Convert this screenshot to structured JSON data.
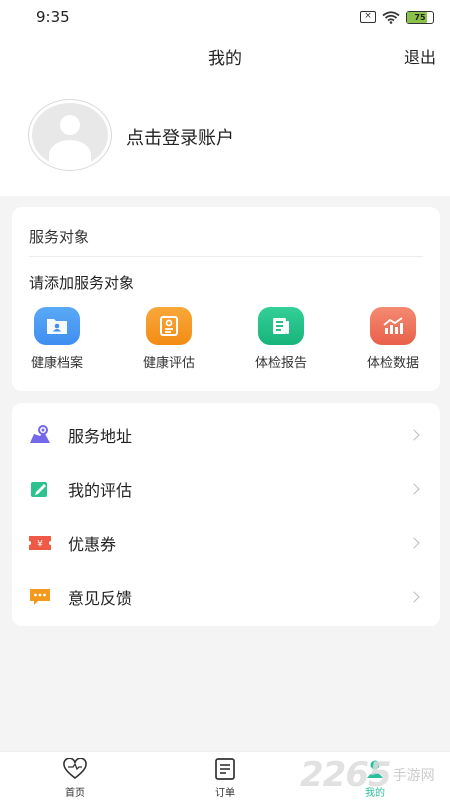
{
  "status_bar": {
    "time": "9:35",
    "battery": "75"
  },
  "header": {
    "title": "我的",
    "logout_label": "退出"
  },
  "profile": {
    "login_text": "点击登录账户"
  },
  "service_card": {
    "title": "服务对象",
    "add_text": "请添加服务对象",
    "items": [
      {
        "label": "健康档案",
        "icon": "folder-icon",
        "color": "#3f97f2"
      },
      {
        "label": "健康评估",
        "icon": "assessment-icon",
        "color": "#f5951f"
      },
      {
        "label": "体检报告",
        "icon": "report-icon",
        "color": "#22c08a"
      },
      {
        "label": "体检数据",
        "icon": "chart-icon",
        "color": "#ef6c57"
      }
    ]
  },
  "menu": {
    "items": [
      {
        "label": "服务地址",
        "icon": "location-icon",
        "color": "#7467ea"
      },
      {
        "label": "我的评估",
        "icon": "edit-icon",
        "color": "#2cc28f"
      },
      {
        "label": "优惠券",
        "icon": "coupon-icon",
        "color": "#ef5a46"
      },
      {
        "label": "意见反馈",
        "icon": "feedback-icon",
        "color": "#f39a1e"
      }
    ]
  },
  "tabbar": {
    "tabs": [
      {
        "label": "首页",
        "icon": "heart-icon",
        "active": false
      },
      {
        "label": "订单",
        "icon": "order-icon",
        "active": false
      },
      {
        "label": "我的",
        "icon": "user-icon",
        "active": true
      }
    ],
    "active_color": "#2bbfa0"
  },
  "watermark": {
    "number": "2265",
    "text": "手游网"
  }
}
